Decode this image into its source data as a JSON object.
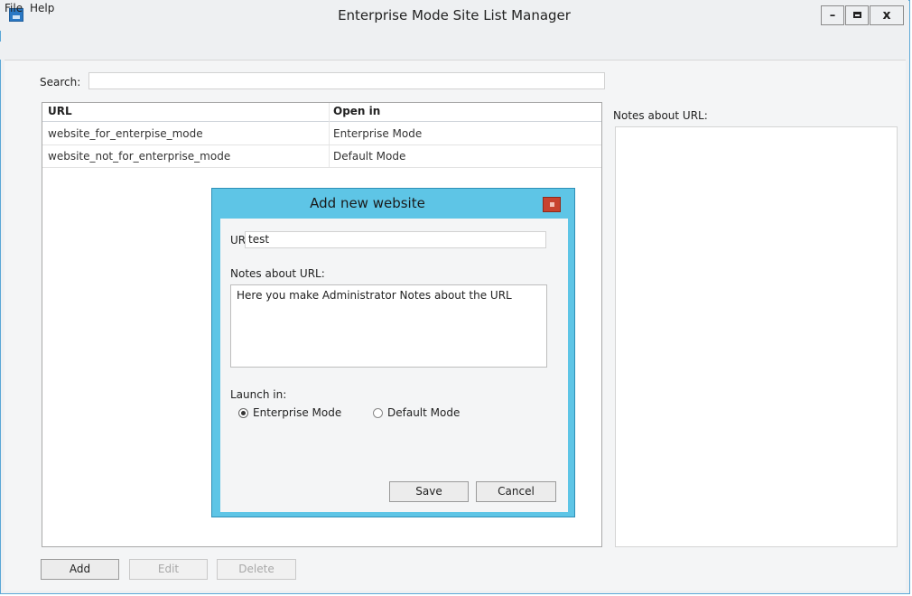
{
  "window": {
    "title": "Enterprise Mode Site List Manager",
    "controls": {
      "minimize": "–",
      "close": "x"
    }
  },
  "menu": {
    "items": [
      "File",
      "Help"
    ]
  },
  "search": {
    "label": "Search:",
    "value": ""
  },
  "site_list": {
    "columns": [
      "URL",
      "Open in"
    ],
    "rows": [
      {
        "url": "website_for_enterpise_mode",
        "open_in": "Enterprise Mode"
      },
      {
        "url": "website_not_for_enterprise_mode",
        "open_in": "Default Mode"
      }
    ]
  },
  "notes_panel": {
    "label": "Notes about URL:"
  },
  "buttons": {
    "add": "Add",
    "edit": "Edit",
    "delete": "Delete"
  },
  "dialog": {
    "title": "Add new website",
    "url_label": "URL:",
    "url_value": "test",
    "notes_label": "Notes about URL:",
    "notes_value": "Here you make Administrator Notes about the URL",
    "launch_label": "Launch in:",
    "options": [
      "Enterprise Mode",
      "Default Mode"
    ],
    "selected_option": "Enterprise Mode",
    "save": "Save",
    "cancel": "Cancel"
  },
  "colors": {
    "window_border": "#5aa7d6",
    "dialog_frame": "#5ec5e6",
    "dialog_close": "#c7432f",
    "app_icon": "#2a78c4"
  }
}
